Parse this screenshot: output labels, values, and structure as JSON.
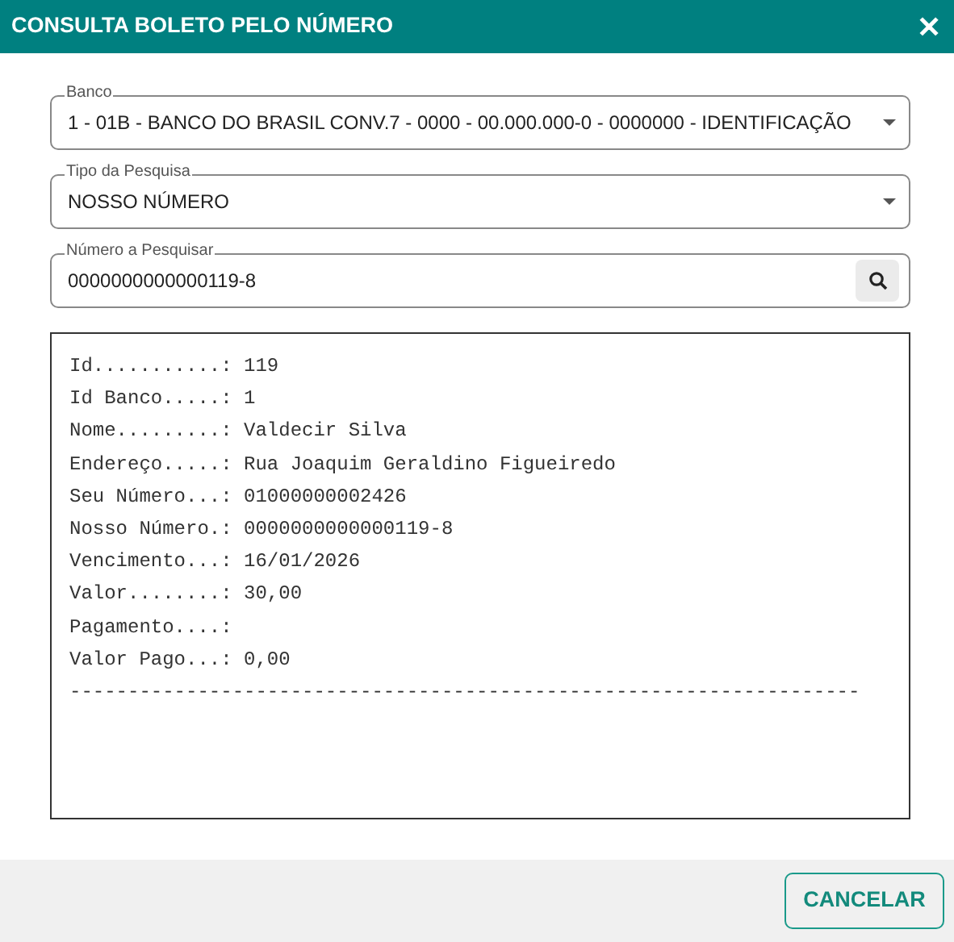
{
  "window": {
    "title": "CONSULTA BOLETO PELO NÚMERO",
    "close": "✕"
  },
  "fields": [
    {
      "kind": "select",
      "label": "Banco",
      "value": "1 - 01B - BANCO DO BRASIL CONV.7 - 0000 - 00.000.000-0 - 0000000 - IDENTIFICAÇÃO"
    },
    {
      "kind": "select",
      "label": "Tipo da Pesquisa",
      "value": "NOSSO NÚMERO"
    },
    {
      "kind": "search",
      "label": "Número a Pesquisar",
      "value": "0000000000000119-8"
    }
  ],
  "result_lines": [
    "Id...........: 119",
    "Id Banco.....: 1",
    "Nome.........: Valdecir Silva",
    "Endereço.....: Rua Joaquim Geraldino Figueiredo",
    "Seu Número...: 01000000002426",
    "Nosso Número.: 0000000000000119-8",
    "Vencimento...: 16/01/2026",
    "Valor........: 30,00",
    "Pagamento....:",
    "Valor Pago...: 0,00",
    "--------------------------------------------------------------------"
  ],
  "buttons": [
    "CANCELAR"
  ]
}
